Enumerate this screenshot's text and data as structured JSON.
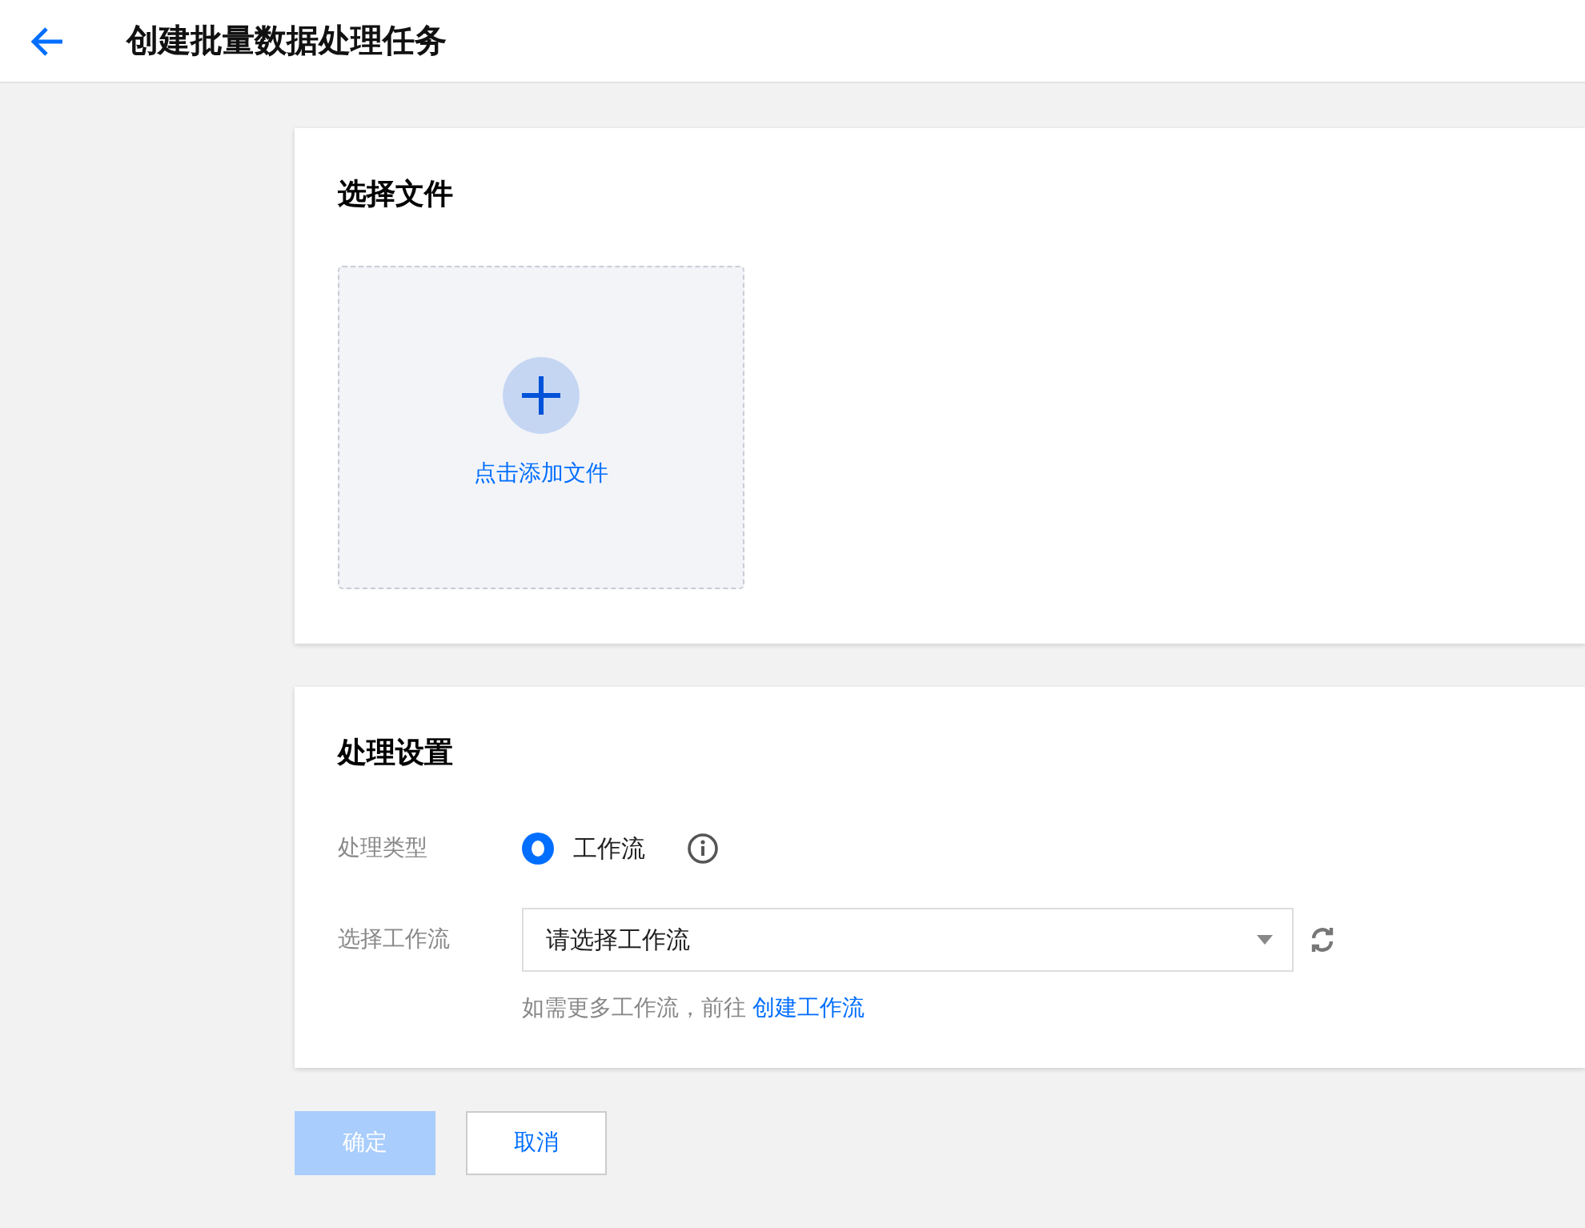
{
  "header": {
    "title": "创建批量数据处理任务"
  },
  "file_section": {
    "title": "选择文件",
    "upload_label": "点击添加文件"
  },
  "settings": {
    "title": "处理设置",
    "fields": [
      {
        "kind": "radio",
        "label": "处理类型",
        "options": [
          {
            "label": "工作流",
            "selected": true
          }
        ]
      },
      {
        "kind": "select",
        "label": "选择工作流",
        "placeholder": "请选择工作流"
      }
    ],
    "hint": "如需更多工作流，前往",
    "hint_link": "创建工作流"
  },
  "buttons": [
    {
      "label": "确定",
      "kind": "primary",
      "disabled": true
    },
    {
      "label": "取消",
      "kind": "secondary",
      "disabled": false
    }
  ]
}
